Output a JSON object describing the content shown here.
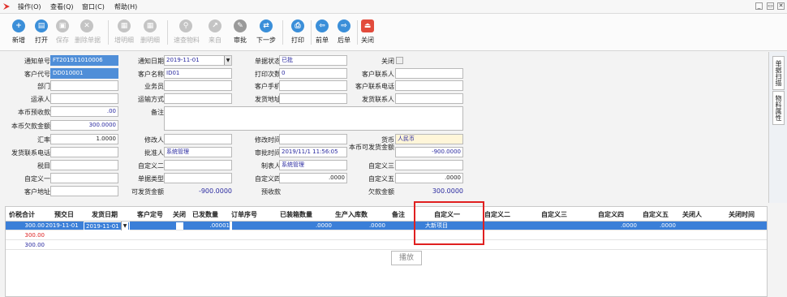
{
  "menu": {
    "items": [
      "操作(O)",
      "查看(Q)",
      "窗口(C)",
      "帮助(H)"
    ],
    "win_min": "_",
    "win_restore": "▭",
    "win_close": "✕"
  },
  "toolbar": {
    "buttons": [
      {
        "label": "新增",
        "icon": "add-icon",
        "glyph": "+",
        "enabled": true
      },
      {
        "label": "打开",
        "icon": "open-icon",
        "glyph": "▤",
        "enabled": true
      },
      {
        "label": "保存",
        "icon": "save-icon",
        "glyph": "▣",
        "enabled": false
      },
      {
        "label": "删除单据",
        "icon": "delete-icon",
        "glyph": "✕",
        "enabled": false
      },
      {
        "label": "增明细",
        "icon": "add-detail-icon",
        "glyph": "▦",
        "enabled": false
      },
      {
        "label": "删明细",
        "icon": "delete-detail-icon",
        "glyph": "▦",
        "enabled": false
      },
      {
        "label": "速查物料",
        "icon": "search-icon",
        "glyph": "⚲",
        "enabled": false
      },
      {
        "label": "来自",
        "icon": "from-icon",
        "glyph": "↗",
        "enabled": false
      },
      {
        "label": "审批",
        "icon": "approve-icon",
        "glyph": "✎",
        "enabled": true
      },
      {
        "label": "下一步",
        "icon": "next-step-icon",
        "glyph": "⇄",
        "enabled": true
      },
      {
        "label": "打印",
        "icon": "print-icon",
        "glyph": "⎙",
        "enabled": true
      },
      {
        "label": "前单",
        "icon": "prev-doc-icon",
        "glyph": "⇦",
        "enabled": true
      },
      {
        "label": "后单",
        "icon": "next-doc-icon",
        "glyph": "⇨",
        "enabled": true
      },
      {
        "label": "关闭",
        "icon": "close-icon",
        "glyph": "⏏",
        "enabled": true
      }
    ]
  },
  "form": {
    "notice_no_label": "通知单号",
    "notice_no": "FT201911010006",
    "notice_date_label": "通知日期",
    "notice_date": "2019-11-01",
    "doc_status_label": "单据状态",
    "doc_status": "已批",
    "closed_label": "关闭",
    "customer_code_label": "客户代号",
    "customer_code": "DD010001",
    "customer_name_label": "客户名称",
    "customer_name": "ID01",
    "print_count_label": "打印次数",
    "print_count": "0",
    "customer_contact_label": "客户联系人",
    "dept_label": "部门",
    "salesman_label": "业务员",
    "customer_phone_label": "客户手机",
    "customer_contact_phone_label": "客户联系电话",
    "carrier_label": "运承人",
    "transport_label": "运输方式",
    "ship_address_label": "发货地址",
    "ship_contact_label": "发货联系人",
    "base_prepaid_label": "本币预收款",
    "base_prepaid": ".00",
    "remark_label": "备注",
    "base_owed_label": "本币欠款金额",
    "base_owed": "300.0000",
    "rate_label": "汇率",
    "rate": "1.0000",
    "modifier_label": "修改人",
    "modify_time_label": "修改时间",
    "currency_label": "货币",
    "currency": "人民币",
    "ship_contact_phone_label": "发货联系电话",
    "approver_label": "批准人",
    "approver": "系统管理",
    "approve_time_label": "审批时间",
    "approve_time": "2019/11/1 11:56:05",
    "base_shippable_label": "本币可发货金额",
    "base_shippable": "-900.0000",
    "tax_label": "税目",
    "custom2_label": "自定义二",
    "maker_label": "制表人",
    "maker": "系统管理",
    "custom3_label": "自定义三",
    "custom1_label": "自定义一",
    "doc_type_label": "单据类型",
    "custom4_label": "自定义四",
    "custom4": ".0000",
    "custom5_label": "自定义五",
    "custom5": ".0000",
    "customer_address_label": "客户地址",
    "shippable_amount_label": "可发货金额",
    "shippable_amount": "-900.0000",
    "advance_label": "预收款",
    "owed_amount_label": "欠款金额",
    "owed_amount": "300.0000"
  },
  "side_tabs": [
    "单据扫描",
    "物料属性"
  ],
  "grid": {
    "headers": [
      "价税合计",
      "预交日",
      "发货日期",
      "客户定号",
      "关闭",
      "已发数量",
      "订单序号",
      "已装箱数量",
      "生产入库数",
      "备注",
      "自定义一",
      "自定义二",
      "自定义三",
      "自定义四",
      "自定义五",
      "关闭人",
      "关闭时间"
    ],
    "row1": {
      "total": "300.00",
      "due_date": "2019-11-01",
      "ship_date": "2019-11-01",
      "shipped_qty": ".00001",
      "packed_qty": ".0000",
      "produced_qty": ".0000",
      "custom1": "大新项目",
      "custom4": ".0000",
      "custom5": ".0000"
    },
    "row2_total": "300.00",
    "row3_total": "300.00"
  },
  "tooltip": "播放",
  "colors": {
    "selection": "#3b7fd8",
    "highlight": "#e02020",
    "red": "#d22"
  }
}
